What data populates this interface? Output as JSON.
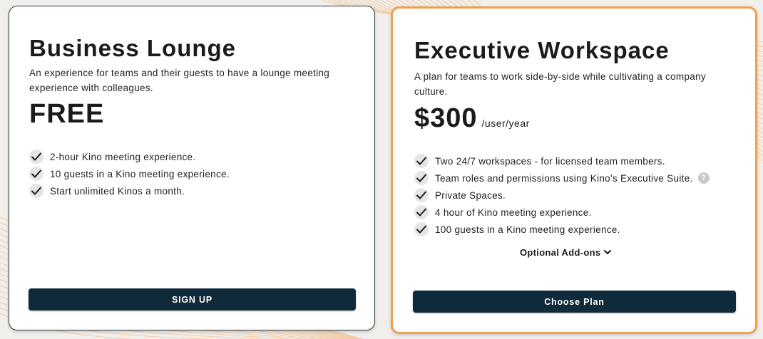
{
  "plans": [
    {
      "title": "Business Lounge",
      "description": "An experience for teams and their guests to have a lounge meeting experience with colleagues.",
      "price": "FREE",
      "price_unit": "",
      "features": [
        "2-hour Kino meeting experience.",
        "10 guests in a Kino meeting experience.",
        "Start unlimited Kinos a month."
      ],
      "button_label": "SIGN UP"
    },
    {
      "title": "Executive Workspace",
      "description": "A plan for teams to work side-by-side while cultivating a company culture.",
      "price": "$300",
      "price_unit": "/user/year",
      "features": [
        "Two 24/7 workspaces - for licensed team members.",
        "Team roles and permissions using Kino's Executive Suite.",
        "Private Spaces.",
        "4 hour of Kino meeting experience.",
        "100 guests in a Kino meeting experience."
      ],
      "help_icon": "question-circle-icon",
      "addons_label": "Optional Add-ons",
      "button_label": "Choose Plan"
    }
  ],
  "icons": {
    "feature_check": "check-circle-icon",
    "addons_toggle": "chevron-down-icon"
  },
  "colors": {
    "background": "#f1efec",
    "highlight_border": "#f0a04b",
    "button": "#0f2a3a",
    "decor_lines": "#f2c79a"
  }
}
